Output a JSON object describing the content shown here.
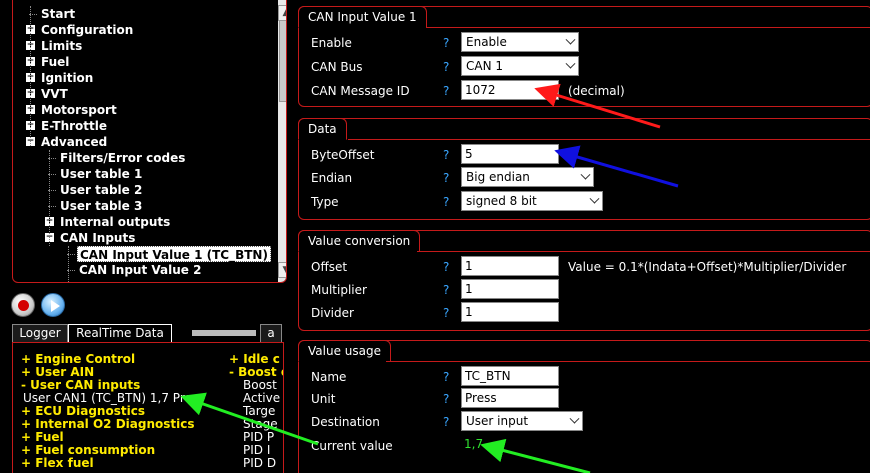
{
  "tree": {
    "items": [
      {
        "label": "Start",
        "level": 0,
        "expander": ""
      },
      {
        "label": "Configuration",
        "level": 0,
        "expander": "+"
      },
      {
        "label": "Limits",
        "level": 0,
        "expander": "+"
      },
      {
        "label": "Fuel",
        "level": 0,
        "expander": "+"
      },
      {
        "label": "Ignition",
        "level": 0,
        "expander": "+"
      },
      {
        "label": "VVT",
        "level": 0,
        "expander": "+"
      },
      {
        "label": "Motorsport",
        "level": 0,
        "expander": "+"
      },
      {
        "label": "E-Throttle",
        "level": 0,
        "expander": "+"
      },
      {
        "label": "Advanced",
        "level": 0,
        "expander": "−"
      },
      {
        "label": "Filters/Error codes",
        "level": 1,
        "expander": ""
      },
      {
        "label": "User table 1",
        "level": 1,
        "expander": ""
      },
      {
        "label": "User table 2",
        "level": 1,
        "expander": ""
      },
      {
        "label": "User table 3",
        "level": 1,
        "expander": ""
      },
      {
        "label": "Internal outputs",
        "level": 1,
        "expander": "+"
      },
      {
        "label": "CAN Inputs",
        "level": 1,
        "expander": "−"
      },
      {
        "label": "CAN Input Value 1 (TC_BTN)",
        "level": 2,
        "expander": "",
        "selected": true
      },
      {
        "label": "CAN Input Value 2",
        "level": 2,
        "expander": ""
      }
    ]
  },
  "tabs": {
    "logger": "Logger",
    "realtime": "RealTime Data",
    "extra": "a"
  },
  "realtime": {
    "left": [
      {
        "text": "+ Engine Control",
        "kind": "cat"
      },
      {
        "text": "+ User AIN",
        "kind": "cat"
      },
      {
        "text": "- User CAN inputs",
        "kind": "cat"
      },
      {
        "text": "User CAN1 (TC_BTN)   1,7 Press",
        "kind": "item"
      },
      {
        "text": "+ ECU Diagnostics",
        "kind": "cat"
      },
      {
        "text": "+ Internal O2 Diagnostics",
        "kind": "cat"
      },
      {
        "text": "+ Fuel",
        "kind": "cat"
      },
      {
        "text": "+ Fuel consumption",
        "kind": "cat"
      },
      {
        "text": "+ Flex fuel",
        "kind": "cat"
      }
    ],
    "right": [
      {
        "text": "+ Idle c",
        "kind": "cat"
      },
      {
        "text": "- Boost c",
        "kind": "cat"
      },
      {
        "text": "Boost",
        "kind": "item"
      },
      {
        "text": "Active",
        "kind": "item"
      },
      {
        "text": "Targe",
        "kind": "item"
      },
      {
        "text": "Stage",
        "kind": "item"
      },
      {
        "text": "PID P",
        "kind": "item"
      },
      {
        "text": "PID I",
        "kind": "item"
      },
      {
        "text": "PID D",
        "kind": "item"
      }
    ]
  },
  "help_glyph": "?",
  "can_input": {
    "title": "CAN Input Value 1",
    "enable_label": "Enable",
    "enable_value": "Enable",
    "bus_label": "CAN Bus",
    "bus_value": "CAN 1",
    "msgid_label": "CAN Message ID",
    "msgid_value": "1072",
    "msgid_unit": "(decimal)"
  },
  "data_group": {
    "title": "Data",
    "offset_label": "ByteOffset",
    "offset_value": "5",
    "endian_label": "Endian",
    "endian_value": "Big endian",
    "type_label": "Type",
    "type_value": "signed 8 bit"
  },
  "conversion": {
    "title": "Value conversion",
    "offset_label": "Offset",
    "offset_value": "1",
    "formula": "Value = 0.1*(Indata+Offset)*Multiplier/Divider",
    "multiplier_label": "Multiplier",
    "multiplier_value": "1",
    "divider_label": "Divider",
    "divider_value": "1"
  },
  "usage": {
    "title": "Value usage",
    "name_label": "Name",
    "name_value": "TC_BTN",
    "unit_label": "Unit",
    "unit_value": "Press",
    "dest_label": "Destination",
    "dest_value": "User input",
    "current_label": "Current value",
    "current_value": "1,7"
  },
  "colors": {
    "border": "#c51a1a",
    "category_text": "#ffeb00",
    "help": "#3aa6ff",
    "current_value": "#30e030",
    "arrow_red": "#ff1a1a",
    "arrow_blue": "#1010e0",
    "arrow_green": "#22ee22"
  }
}
